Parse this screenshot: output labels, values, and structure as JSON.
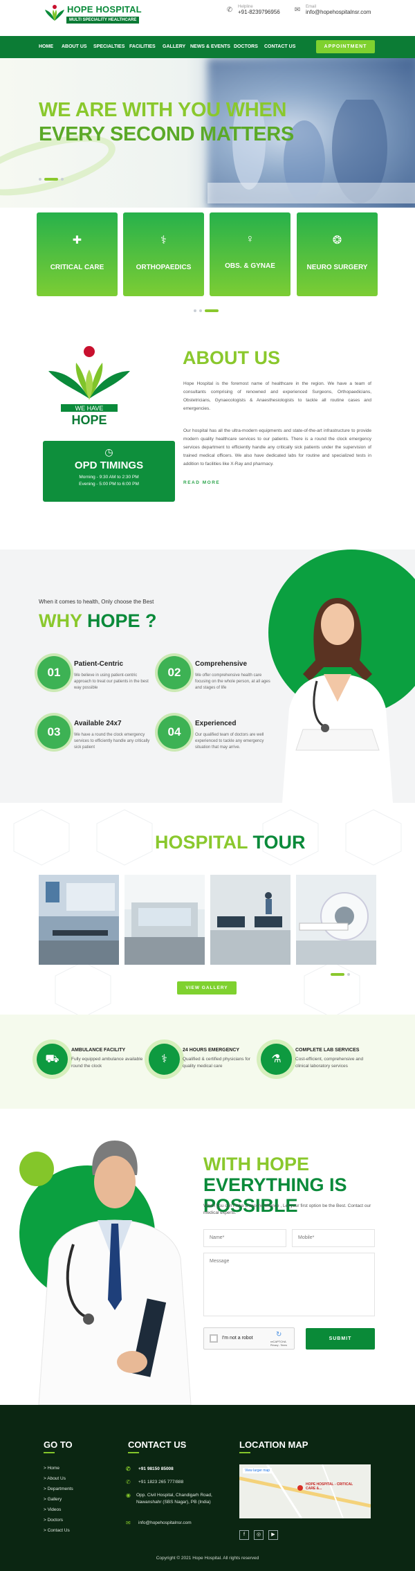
{
  "header": {
    "brand_title": "HOPE HOSPITAL",
    "brand_subtitle": "MULTI SPECIALITY HEALTHCARE",
    "helpline_label": "Helpline",
    "helpline_value": "+91-8239796956",
    "email_label": "Email",
    "email_value": "info@hopehospitalnsr.com"
  },
  "nav": {
    "items": [
      "HOME",
      "ABOUT US",
      "SPECIALTIES",
      "FACILITIES",
      "GALLERY",
      "NEWS & EVENTS",
      "DOCTORS",
      "CONTACT US"
    ],
    "appointment": "APPOINTMENT"
  },
  "hero": {
    "line1": "WE ARE WITH YOU WHEN",
    "line2": "EVERY SECOND MATTERS"
  },
  "specialties": [
    {
      "label": "CRITICAL CARE",
      "icon": "heart-pulse-icon"
    },
    {
      "label": "ORTHOPAEDICS",
      "icon": "bone-icon"
    },
    {
      "label": "OBS. & GYNAE",
      "icon": "pregnant-icon"
    },
    {
      "label": "NEURO SURGERY",
      "icon": "brain-icon"
    }
  ],
  "about": {
    "logo_tag1": "WE HAVE",
    "logo_tag2": "HOPE",
    "title": "ABOUT US",
    "para1": "Hope Hospital is the foremost name of healthcare in the region. We have a team of consultants comprising of renowned and experienced Surgeons, Orthopaedicians, Obstetricians, Gynaecologists & Anaesthesiologists to tackle all routine cases and emergencies.",
    "para2": "Our hospital has all the ultra-modern equipments and state-of-the-art infrastructure to provide modern quality healthcare services to our patients. There is a round the clock emergency services department to efficiently handle any critically sick patients under the supervision of trained medical officers. We also have dedicated labs for routine and specialized tests in addition to facilities like X-Ray and pharmacy.",
    "read_more": "READ MORE",
    "opd_title": "OPD TIMINGS",
    "opd_morning": "Morning - 9:30 AM to 2:30 PM",
    "opd_evening": "Evening - 5:00 PM to 6:00 PM"
  },
  "why": {
    "kicker": "When it comes to health, Only choose the  Best",
    "title_a": "WHY ",
    "title_b": "HOPE ?",
    "features": [
      {
        "num": "01",
        "title": "Patient-Centric",
        "desc": "We believe in using patient-centric approach to treat our patients in the best way possible"
      },
      {
        "num": "02",
        "title": "Comprehensive",
        "desc": "We offer comprehensive health care focusing on the whole person, at all ages and stages of life"
      },
      {
        "num": "03",
        "title": "Available 24x7",
        "desc": "We have a round the clock emergency services to efficiently handle any critically sick patient"
      },
      {
        "num": "04",
        "title": "Experienced",
        "desc": "Our qualified team of doctors are well experienced to tackle any emergency situation that may arrive."
      }
    ]
  },
  "tour": {
    "title_a": "HOSPITAL ",
    "title_b": "TOUR",
    "button": "VIEW GALLERY"
  },
  "services": [
    {
      "title": "AMBULANCE FACILITY",
      "desc": "Fully equipped ambulance available round the clock",
      "icon": "ambulance-icon"
    },
    {
      "title": "24 HOURS EMERGENCY",
      "desc": "Qualified & certified physicians for quality medical care",
      "icon": "doctor-icon"
    },
    {
      "title": "COMPLETE LAB SERVICES",
      "desc": "Cost-efficient, comprehensive and clinical laboratory services",
      "icon": "flask-icon"
    }
  ],
  "contact": {
    "title_a": "WITH HOPE",
    "title_b": "EVERYTHING IS POSSIBLE",
    "sub": "When you can't take a second chance , Let your first option be the Best. Contact our medical experts.",
    "name_ph": "Name*",
    "mobile_ph": "Mobile*",
    "message_ph": "Message",
    "captcha": "I'm not a robot",
    "captcha_brand": "reCAPTCHA",
    "captcha_terms": "Privacy - Terms",
    "submit": "SUBMIT"
  },
  "footer": {
    "goto_title": "GO TO",
    "links": [
      "> Home",
      "> About Us",
      "> Departments",
      "> Gallery",
      "> Videos",
      "> Doctors",
      "> Contact Us"
    ],
    "contact_title": "CONTACT US",
    "phone1": "+91 98150 85008",
    "phone2": "+91 1823 265 777/888",
    "address": "Opp. Civil Hospital, Chandigarh Road, Nawanshahr (SBS Nagar), PB (India)",
    "email": "info@hopehospitalnsr.com",
    "map_title": "LOCATION MAP",
    "map_link": "View larger map",
    "map_place": "HOPE HOSPITAL - CRITICAL CARE &...",
    "copyright": "Copyright © 2021 Hope Hospital. All rights reserved"
  }
}
